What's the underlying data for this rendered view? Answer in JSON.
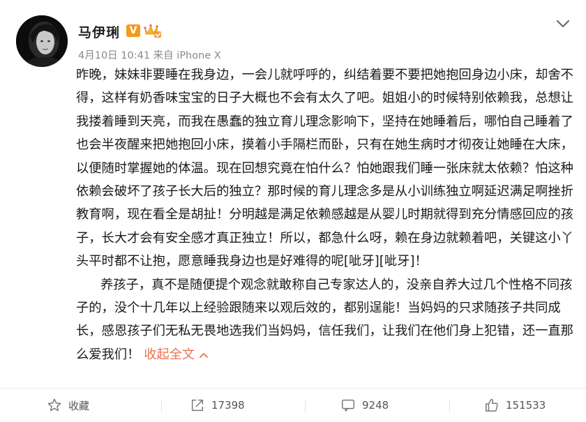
{
  "post": {
    "author": {
      "name": "马伊琍",
      "verified_badge": "V"
    },
    "meta": "4月10日 10:41 来自 iPhone X",
    "paragraphs": [
      "昨晚，妹妹非要睡在我身边，一会儿就呼呼的，纠结着要不要把她抱回身边小床，却舍不得，这样有奶香味宝宝的日子大概也不会有太久了吧。姐姐小的时候特别依赖我，总想让我搂着睡到天亮，而我在愚蠢的独立育儿理念影响下，坚持在她睡着后，哪怕自己睡着了也会半夜醒来把她抱回小床，摸着小手隔栏而卧，只有在她生病时才彻夜让她睡在大床，以便随时掌握她的体温。现在回想究竟在怕什么？怕她跟我们睡一张床就太依赖？怕这种依赖会破坏了孩子长大后的独立？那时候的育儿理念多是从小训练独立啊延迟满足啊挫折教育啊，现在看全是胡扯！分明越是满足依赖感越是从婴儿时期就得到充分情感回应的孩子，长大才会有安全感才真正独立！所以，都急什么呀，赖在身边就赖着吧，关键这小丫头平时都不让抱，愿意睡我身边也是好难得的呢[呲牙][呲牙]！",
      "养孩子，真不是随便提个观念就敢称自己专家达人的，没亲自养大过几个性格不同孩子的，没个十几年以上经验跟随来以观后效的，都别逞能！当妈妈的只求随孩子共同成长，感恩孩子们无私无畏地选我们当妈妈，信任我们，让我们在他们身上犯错，还一直那么爱我们！"
    ],
    "collapse_label": "收起全文",
    "collapse_icon": "chevron-up-icon"
  },
  "actions": {
    "favorite": {
      "label": "收藏",
      "icon": "star-icon"
    },
    "repost": {
      "label": "17398",
      "icon": "repost-icon"
    },
    "comment": {
      "label": "9248",
      "icon": "comment-icon"
    },
    "like": {
      "label": "151533",
      "icon": "thumbs-up-icon"
    }
  },
  "colors": {
    "accent_link": "#eb7350",
    "vip_badge": "#f59a1a",
    "meta_text": "#8a8a8a",
    "icon_gray": "#777777"
  }
}
